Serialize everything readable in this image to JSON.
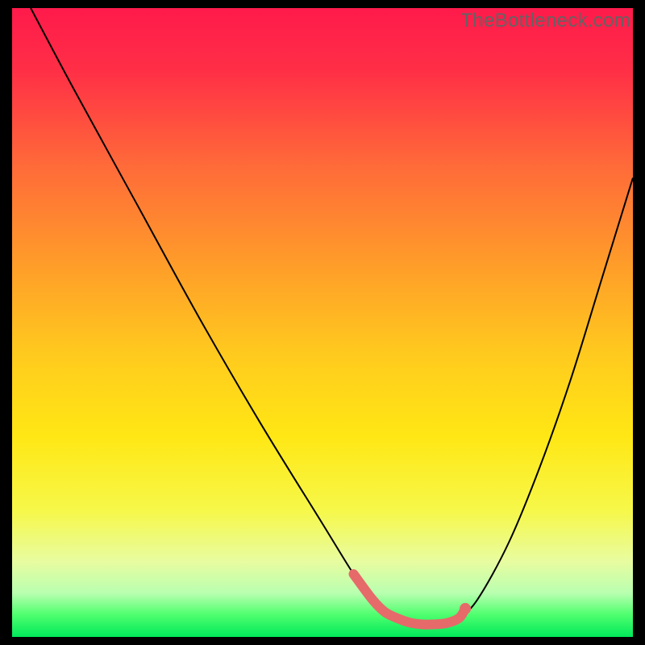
{
  "watermark": {
    "text": "TheBottleneck.com"
  },
  "chart_data": {
    "type": "line",
    "title": "",
    "xlabel": "",
    "ylabel": "",
    "xlim": [
      0,
      100
    ],
    "ylim": [
      0,
      100
    ],
    "curve": {
      "x": [
        3,
        10,
        20,
        30,
        40,
        50,
        55,
        58,
        62,
        66,
        70,
        72,
        75,
        80,
        85,
        90,
        95,
        100
      ],
      "y": [
        100,
        87,
        69,
        51,
        34,
        18,
        10,
        6,
        3,
        2,
        2,
        3,
        6,
        15,
        27,
        41,
        57,
        73
      ]
    },
    "highlight_band": {
      "x": [
        55,
        58,
        60,
        62,
        64,
        66,
        68,
        70,
        72,
        73
      ],
      "y": [
        10,
        6,
        4,
        3,
        2.3,
        2,
        2,
        2.2,
        3,
        4.5
      ]
    },
    "highlight_dot": {
      "x": 73,
      "y": 4.5
    },
    "gradient_stops": [
      {
        "offset": 0.0,
        "color": "#ff1a4b"
      },
      {
        "offset": 0.1,
        "color": "#ff2f46"
      },
      {
        "offset": 0.25,
        "color": "#ff6a39"
      },
      {
        "offset": 0.4,
        "color": "#ff9a2a"
      },
      {
        "offset": 0.55,
        "color": "#ffca1e"
      },
      {
        "offset": 0.68,
        "color": "#ffe714"
      },
      {
        "offset": 0.8,
        "color": "#f6f84a"
      },
      {
        "offset": 0.88,
        "color": "#e8fca0"
      },
      {
        "offset": 0.93,
        "color": "#b9ffb0"
      },
      {
        "offset": 0.965,
        "color": "#4eff6e"
      },
      {
        "offset": 1.0,
        "color": "#00e85a"
      }
    ],
    "curve_stroke": "#000000",
    "highlight_stroke": "#e66a6a"
  }
}
